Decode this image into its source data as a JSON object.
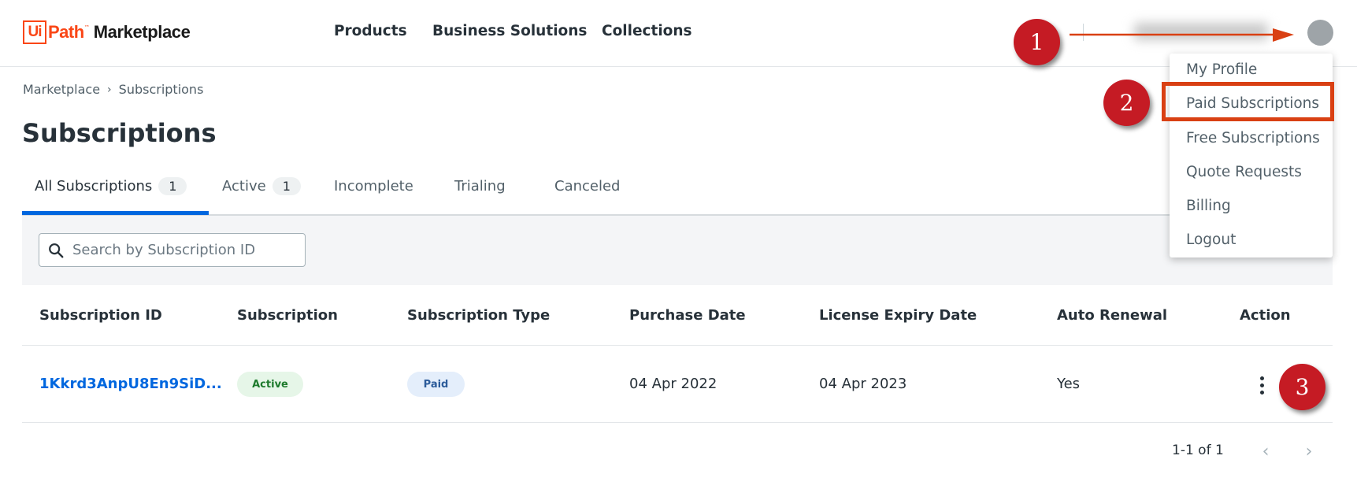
{
  "header": {
    "logo_ui": "Ui",
    "logo_path": "Path",
    "logo_tm": "™",
    "logo_marketplace": "Marketplace",
    "nav": [
      "Products",
      "Business Solutions",
      "Collections"
    ]
  },
  "breadcrumb": [
    "Marketplace",
    "Subscriptions"
  ],
  "page_title": "Subscriptions",
  "tabs": [
    {
      "label": "All Subscriptions",
      "count": "1"
    },
    {
      "label": "Active",
      "count": "1"
    },
    {
      "label": "Incomplete"
    },
    {
      "label": "Trialing"
    },
    {
      "label": "Canceled"
    }
  ],
  "search": {
    "placeholder": "Search by Subscription ID"
  },
  "table": {
    "columns": [
      "Subscription ID",
      "Subscription",
      "Subscription Type",
      "Purchase Date",
      "License Expiry Date",
      "Auto Renewal",
      "Action"
    ],
    "rows": [
      {
        "id": "1Kkrd3AnpU8En9SiD...",
        "status": "Active",
        "type": "Paid",
        "purchase_date": "04 Apr 2022",
        "expiry_date": "04 Apr 2023",
        "auto_renewal": "Yes"
      }
    ]
  },
  "pagination": {
    "summary": "1-1 of 1"
  },
  "user_menu": {
    "items": [
      "My Profile",
      "Paid Subscriptions",
      "Free Subscriptions",
      "Quote Requests",
      "Billing",
      "Logout"
    ]
  },
  "annotations": [
    "1",
    "2",
    "3"
  ],
  "colors": {
    "accent": "#0067df",
    "brand": "#fa4616",
    "marker": "#c51b24",
    "highlight": "#d94013"
  }
}
